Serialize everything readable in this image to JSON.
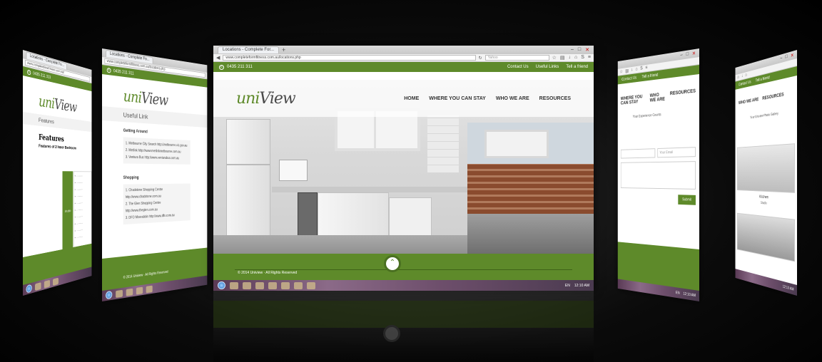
{
  "colors": {
    "brand_green": "#5e8a2a",
    "dark_green": "#3f6318"
  },
  "center": {
    "tab_title": "Locations - Complete For...",
    "url": "www.completeformfitness.com.au/locations.php",
    "search_placeholder": "Yahoo",
    "phone": "0435 211 311",
    "top_links": [
      "Contact Us",
      "Useful Links",
      "Tell a friend"
    ],
    "logo": {
      "part1": "uni",
      "part2": "View"
    },
    "nav": [
      "HOME",
      "WHERE YOU CAN STAY",
      "WHO WE ARE",
      "RESOURCES"
    ],
    "copyright": "© 2014 Uniview · All Rights Reserved",
    "tray": {
      "lang": "EN",
      "time": "12:10 AM"
    }
  },
  "left_back": {
    "tab_title": "Locations - Complete Fo...",
    "url": "www.completeformfitness.com.au/",
    "phone": "0435 211 311",
    "logo": {
      "part1": "uni",
      "part2": "View"
    },
    "breadcrumb": "Features",
    "heading": "Features",
    "subheading": "Features of 2 Inner Bedroom",
    "row_label": "Studio"
  },
  "left_front": {
    "tab_title": "Locations - Complete Fo...",
    "url": "www.completeformfitness.com.au/locations.php",
    "phone": "0435 211 311",
    "logo": {
      "part1": "uni",
      "part2": "View"
    },
    "title": "Useful Link",
    "getting_around": {
      "heading": "Getting Around",
      "items": [
        "1. Melbourne City Search   http://melbourne.vic.gov.au",
        "2. Metlink   http://www.metlinkmelbourne.com.au",
        "3. Ventura Bus   http://www.venturabus.com.au"
      ]
    },
    "shopping": {
      "heading": "Shopping",
      "items": [
        "1. Chadstone Shopping Centre   http://www.chadstone.com.au",
        "2. The Glen Shopping Centre   http://www.theglen.com.au",
        "3. DFO Moorabbin   http://www.dfo.com.au"
      ]
    },
    "copyright": "© 2014 Uniview · All Rights Reserved"
  },
  "right_front": {
    "top_links": [
      "Contact Us",
      "Tell a friend"
    ],
    "nav": [
      "WHERE YOU CAN STAY",
      "WHO WE ARE",
      "RESOURCES"
    ],
    "heading": "Your Experience Counts",
    "field1": "",
    "field2": "Your Email",
    "submit": "Submit",
    "tray": {
      "lang": "EN",
      "time": "12:10 AM"
    }
  },
  "right_back": {
    "top_links": [
      "Contact Us",
      "Tell a friend"
    ],
    "nav": [
      "WHO WE ARE",
      "RESOURCES"
    ],
    "heading": "Your Uniview Photo Gallery",
    "caption": "Kitchen",
    "subcaption": "Studio",
    "tray": {
      "time": "12:10 AM"
    }
  }
}
